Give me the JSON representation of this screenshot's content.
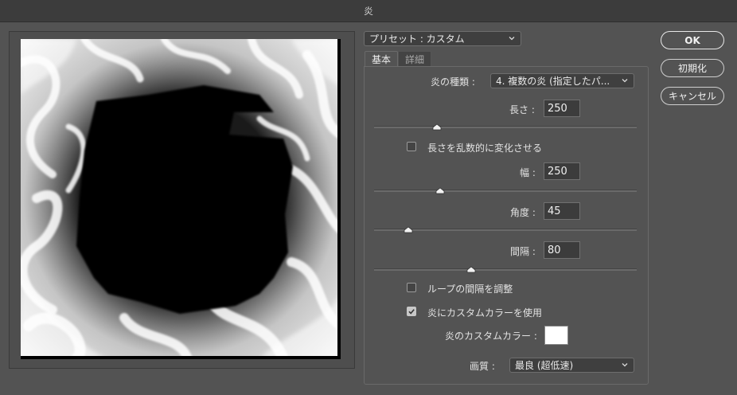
{
  "window": {
    "title": "炎"
  },
  "preset": {
    "label": "プリセット : カスタム"
  },
  "tabs": [
    {
      "label": "基本"
    },
    {
      "label": "詳細"
    }
  ],
  "flame_type": {
    "label": "炎の種類 :",
    "value": "4. 複数の炎 (指定したパ..."
  },
  "length": {
    "label": "長さ :",
    "value": "250",
    "slider_fraction": 0.24
  },
  "randomize_length": {
    "label": "長さを乱数的に変化させる",
    "checked": false
  },
  "width": {
    "label": "幅 :",
    "value": "250",
    "slider_fraction": 0.25
  },
  "angle": {
    "label": "角度 :",
    "value": "45",
    "slider_fraction": 0.13
  },
  "interval": {
    "label": "間隔 :",
    "value": "80",
    "slider_fraction": 0.37
  },
  "adjust_loop_interval": {
    "label": "ループの間隔を調整",
    "checked": false
  },
  "use_custom_color": {
    "label": "炎にカスタムカラーを使用",
    "checked": true
  },
  "custom_color": {
    "label": "炎のカスタムカラー :",
    "color": "#ffffff"
  },
  "quality": {
    "label": "画質 :",
    "value": "最良 (超低速)"
  },
  "buttons": {
    "ok": "OK",
    "reset": "初期化",
    "cancel": "キャンセル"
  }
}
